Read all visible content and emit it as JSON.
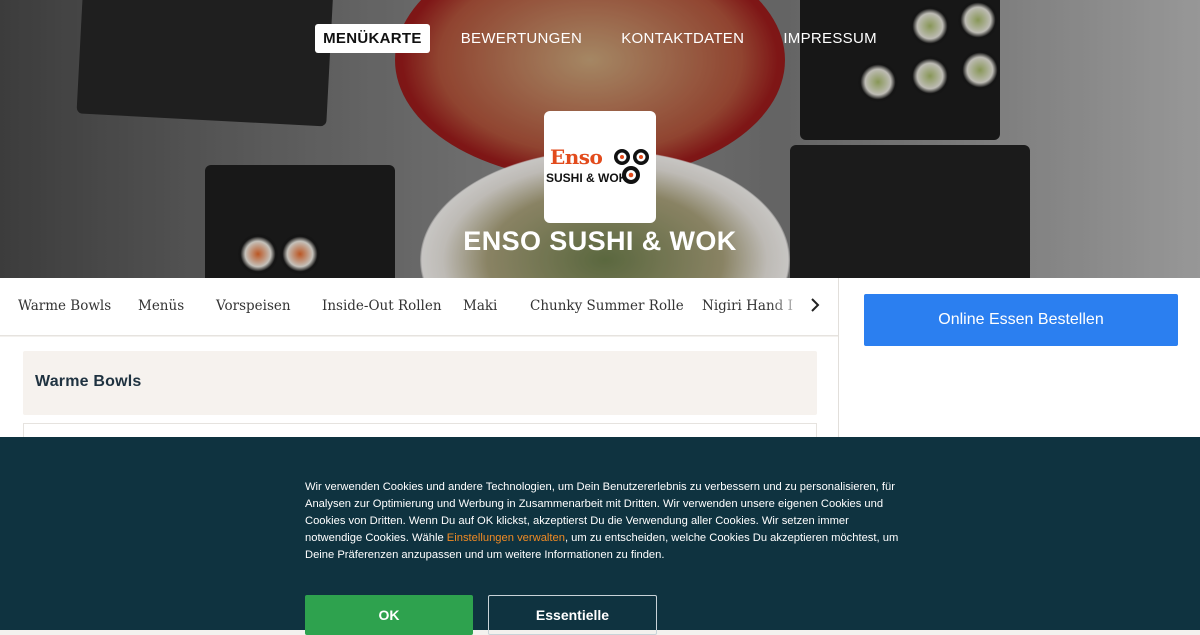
{
  "nav": {
    "items": [
      {
        "label": "MENÜKARTE",
        "active": true
      },
      {
        "label": "BEWERTUNGEN",
        "active": false
      },
      {
        "label": "KONTAKTDATEN",
        "active": false
      },
      {
        "label": "IMPRESSUM",
        "active": false
      }
    ]
  },
  "hero": {
    "logo_brand": "Enso",
    "logo_sub": "SUSHI & WOK",
    "restaurant_name": "ENSO SUSHI & WOK"
  },
  "categories": {
    "items": [
      "Warme Bowls",
      "Menüs",
      "Vorspeisen",
      "Inside-Out Rollen",
      "Maki",
      "Chunky Summer Rolle",
      "Nigiri Hand I"
    ],
    "next_icon": "chevron-right-icon"
  },
  "sidebar": {
    "order_button": "Online Essen Bestellen"
  },
  "main": {
    "section_title": "Warme Bowls"
  },
  "cookie": {
    "text_before_link": "Wir verwenden Cookies und andere Technologien, um Dein Benutzererlebnis zu verbessern und zu personalisieren, für Analysen zur Optimierung und Werbung in Zusammenarbeit mit Dritten. Wir verwenden unsere eigenen Cookies und Cookies von Dritten. Wenn Du auf OK klickst, akzeptierst Du die Verwendung aller Cookies. Wir setzen immer notwendige Cookies. Wähle ",
    "link_text": "Einstellungen verwalten",
    "text_after_link": ", um zu entscheiden, welche Cookies Du akzeptieren möchtest, um Deine Präferenzen anzupassen und um weitere Informationen zu finden.",
    "ok_button": "OK",
    "essential_button": "Essentielle"
  },
  "colors": {
    "order_button": "#2b7ff0",
    "cookie_bg": "#0f3340",
    "ok_button": "#2ea24e",
    "link": "#f08a24"
  }
}
